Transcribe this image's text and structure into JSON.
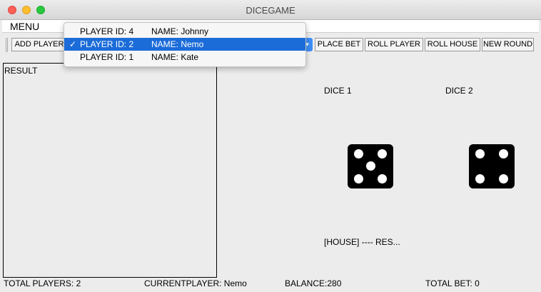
{
  "window": {
    "title": "DICEGAME"
  },
  "menubar": {
    "menu_label": "MENU"
  },
  "toolbar": {
    "add_player_label": "ADD PLAYER",
    "place_bet_label": "PLACE BET",
    "roll_player_label": "ROLL PLAYER",
    "roll_house_label": "ROLL HOUSE",
    "new_round_label": "NEW ROUND"
  },
  "player_dropdown": {
    "check_glyph": "✓",
    "options": [
      {
        "id_label": "PLAYER ID: 4",
        "name_label": "NAME: Johnny",
        "selected": false
      },
      {
        "id_label": "PLAYER ID: 2",
        "name_label": "NAME: Nemo",
        "selected": true
      },
      {
        "id_label": "PLAYER ID: 1",
        "name_label": "NAME: Kate",
        "selected": false
      }
    ]
  },
  "result_panel": {
    "label": "RESULT"
  },
  "dice": {
    "dice1": {
      "label": "DICE 1",
      "value": 5,
      "icon": "die-five-icon"
    },
    "dice2": {
      "label": "DICE 2",
      "value": 4,
      "icon": "die-four-icon"
    }
  },
  "house_result": "[HOUSE] ---- RES...",
  "status": {
    "total_players": "TOTAL PLAYERS: 2",
    "current_player": "CURRENTPLAYER: Nemo",
    "balance": "BALANCE:280",
    "total_bet": "TOTAL BET: 0"
  },
  "colors": {
    "selection": "#1b6cd8",
    "die": "#000000",
    "pip": "#ffffff"
  }
}
